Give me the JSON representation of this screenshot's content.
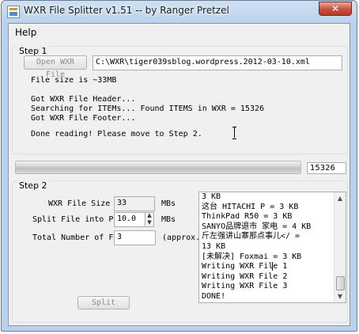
{
  "window": {
    "title": "WXR File Splitter v1.51 -- by Ranger Pretzel",
    "close_glyph": "✕"
  },
  "menu": {
    "help_label": "Help"
  },
  "step1": {
    "label": "Step 1",
    "open_button_label": "Open WXR File",
    "file_path": "C:\\WXR\\tiger039sblog.wordpress.2012-03-10.xml",
    "log_lines": [
      "File size is ~33MB",
      "",
      "Got WXR File Header...",
      "Searching for ITEMs... Found ITEMS in WXR = 15326",
      "Got WXR File Footer...",
      "",
      "Done reading! Please move to Step 2."
    ]
  },
  "progress": {
    "fraction": 1.0,
    "count_text": "15326"
  },
  "step2": {
    "label": "Step 2",
    "file_size_label": "WXR File Size =",
    "file_size_value": "33",
    "file_size_unit": "MBs",
    "split_into_label": "Split File into Pa",
    "split_into_value": "10.0",
    "split_into_unit": "MBs",
    "total_files_label": "Total Number of Fi",
    "total_files_value": "3",
    "total_files_suffix": "(approx.)",
    "split_button_label": "Split",
    "output_lines": [
      "3 KB",
      "这台 HITACHI P = 3 KB",
      "ThinkPad R50 = 3 KB",
      "SANYO品牌退市 家电 = 4 KB",
      "斤左强讲山寨那点事儿</ =",
      "13 KB",
      "[未解决] Foxmai = 3 KB",
      "Writing WXR File 1",
      "Writing WXR File 2",
      "Writing WXR File 3",
      "DONE!"
    ]
  },
  "icons": {
    "app": "app-icon",
    "close": "close-icon",
    "spin_up": "▲",
    "spin_down": "▼",
    "scroll_up": "▲",
    "scroll_down": "▼"
  }
}
